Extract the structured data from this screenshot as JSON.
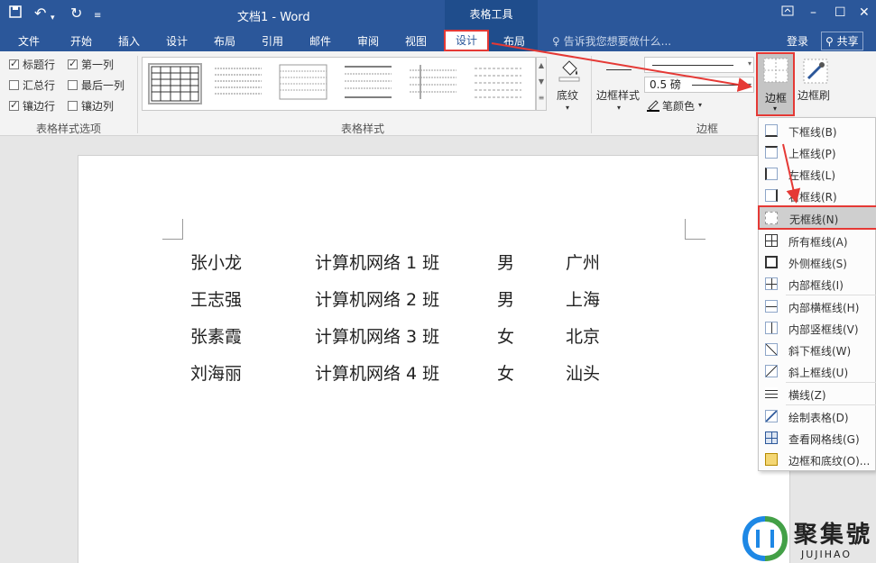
{
  "titlebar": {
    "doc_title": "文档1 - Word",
    "context_group": "表格工具",
    "icons": [
      "save-icon",
      "undo-icon",
      "redo-icon",
      "customize-icon"
    ],
    "window_controls": [
      "restore-ribbon-icon",
      "minimize-icon",
      "maximize-icon",
      "close-icon"
    ]
  },
  "tabs": [
    "文件",
    "开始",
    "插入",
    "设计",
    "布局",
    "引用",
    "邮件",
    "审阅",
    "视图"
  ],
  "context_tabs": {
    "design": "设计",
    "layout": "布局"
  },
  "tellme": "告诉我您想要做什么...",
  "login": "登录",
  "share": "共享",
  "style_options": {
    "items": [
      {
        "label": "标题行",
        "checked": true
      },
      {
        "label": "第一列",
        "checked": true
      },
      {
        "label": "汇总行",
        "checked": false
      },
      {
        "label": "最后一列",
        "checked": false
      },
      {
        "label": "镶边行",
        "checked": true
      },
      {
        "label": "镶边列",
        "checked": false
      }
    ],
    "group_label": "表格样式选项"
  },
  "table_styles": {
    "group_label": "表格样式",
    "shading_label": "底纹"
  },
  "borders_group": {
    "border_style_label": "边框样式",
    "weight": "0.5 磅",
    "pen_color_label": "笔颜色",
    "borders_label": "边框",
    "border_painter_label": "边框刷",
    "group_label": "边框"
  },
  "dropdown": [
    {
      "label": "下框线(B)",
      "icon": "bottom-border-icon"
    },
    {
      "label": "上框线(P)",
      "icon": "top-border-icon"
    },
    {
      "label": "左框线(L)",
      "icon": "left-border-icon"
    },
    {
      "label": "右框线(R)",
      "icon": "right-border-icon"
    },
    {
      "label": "无框线(N)",
      "icon": "no-border-icon",
      "highlighted": true
    },
    {
      "label": "所有框线(A)",
      "icon": "all-borders-icon"
    },
    {
      "label": "外侧框线(S)",
      "icon": "outside-borders-icon"
    },
    {
      "label": "内部框线(I)",
      "icon": "inside-borders-icon"
    },
    {
      "label": "内部横框线(H)",
      "icon": "inside-horizontal-border-icon"
    },
    {
      "label": "内部竖框线(V)",
      "icon": "inside-vertical-border-icon"
    },
    {
      "label": "斜下框线(W)",
      "icon": "diagonal-down-border-icon"
    },
    {
      "label": "斜上框线(U)",
      "icon": "diagonal-up-border-icon"
    },
    {
      "label": "横线(Z)",
      "icon": "horizontal-line-icon"
    },
    {
      "label": "绘制表格(D)",
      "icon": "draw-table-icon"
    },
    {
      "label": "查看网格线(G)",
      "icon": "view-gridlines-icon"
    },
    {
      "label": "边框和底纹(O)...",
      "icon": "borders-shading-icon"
    }
  ],
  "table": {
    "rows": [
      [
        "张小龙",
        "计算机网络 1 班",
        "男",
        "广州"
      ],
      [
        "王志强",
        "计算机网络 2 班",
        "男",
        "上海"
      ],
      [
        "张素霞",
        "计算机网络 3 班",
        "女",
        "北京"
      ],
      [
        "刘海丽",
        "计算机网络 4 班",
        "女",
        "汕头"
      ]
    ]
  },
  "watermark": {
    "text": "聚集號",
    "sub": "JUJIHAO"
  },
  "colors": {
    "brand": "#2b579a",
    "highlight_red": "#e53935"
  }
}
